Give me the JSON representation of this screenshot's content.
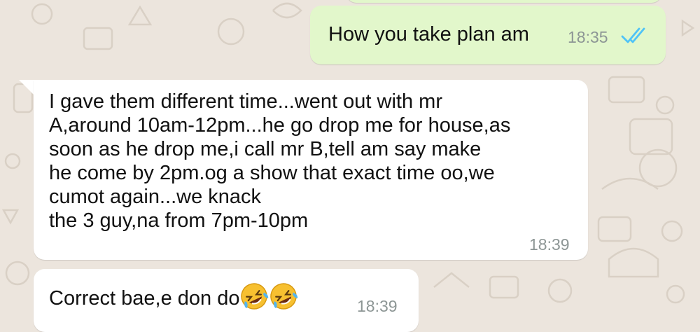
{
  "messages": [
    {
      "direction": "outgoing",
      "text": "How you take plan am",
      "time": "18:35",
      "status": "read-double-tick"
    },
    {
      "direction": "incoming",
      "text": "I gave them different time...went out with mr\nA,around 10am-12pm...he go drop me for house,as\nsoon as he drop me,i call mr B,tell am say make\nhe come by 2pm.og a show that exact time oo,we\ncumot again...we knack\nthe 3 guy,na from 7pm-10pm",
      "time": "18:39"
    },
    {
      "direction": "incoming",
      "text": "Correct bae,e don do",
      "emojis": [
        "rolling-on-the-floor-laughing-emoji",
        "rolling-on-the-floor-laughing-emoji"
      ],
      "time": "18:39"
    }
  ],
  "colors": {
    "wallpaper": "#ece5dd",
    "outgoing_bubble": "#e2f7cb",
    "incoming_bubble": "#ffffff",
    "read_ticks": "#4fc3f7",
    "timestamp": "#8d9695"
  }
}
